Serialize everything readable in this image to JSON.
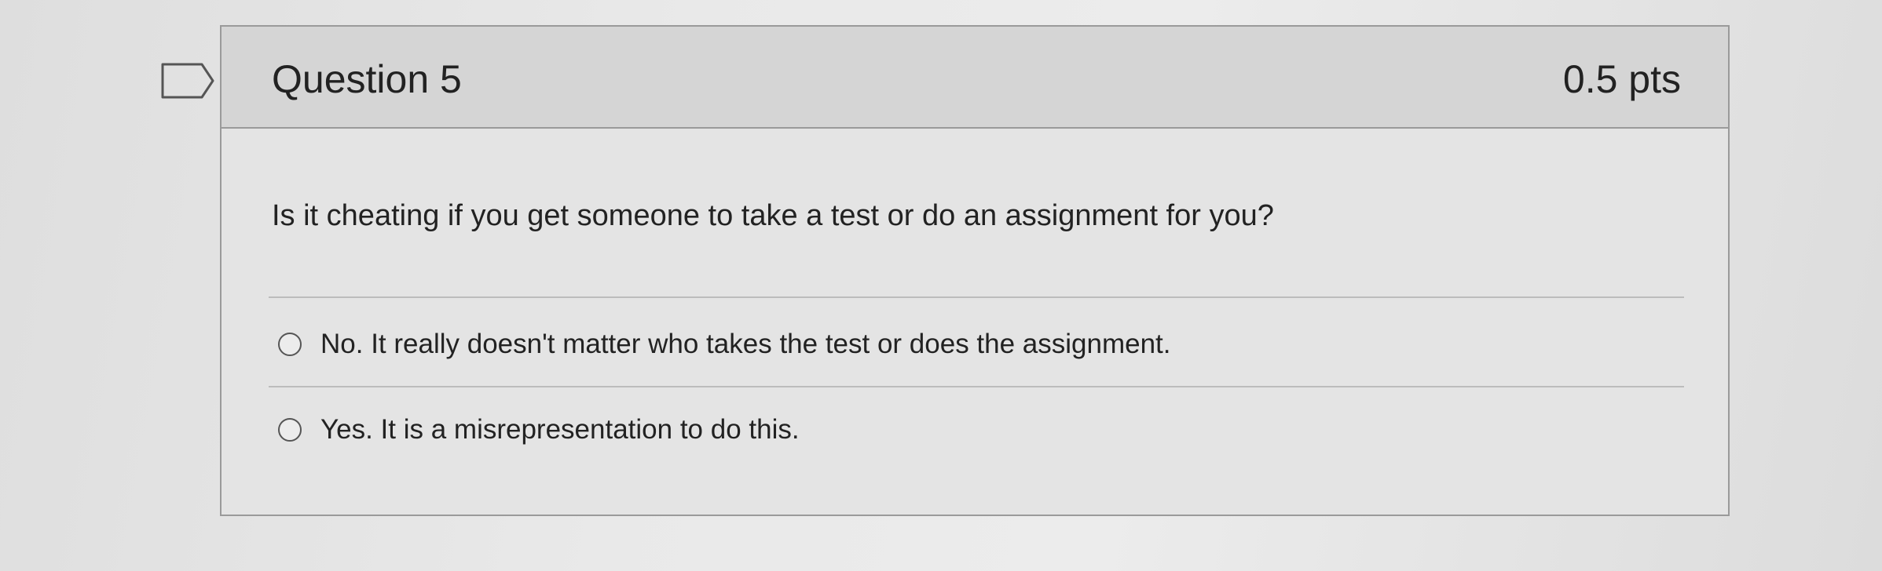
{
  "question": {
    "title": "Question 5",
    "points": "0.5 pts",
    "text": "Is it cheating if you get someone to take a test or do an assignment for you?",
    "flag_icon": "flag-icon",
    "answers": [
      {
        "label": "No. It really doesn't matter who takes the test or does the assignment.",
        "selected": false
      },
      {
        "label": "Yes. It is a misrepresentation to do this.",
        "selected": false
      }
    ]
  }
}
